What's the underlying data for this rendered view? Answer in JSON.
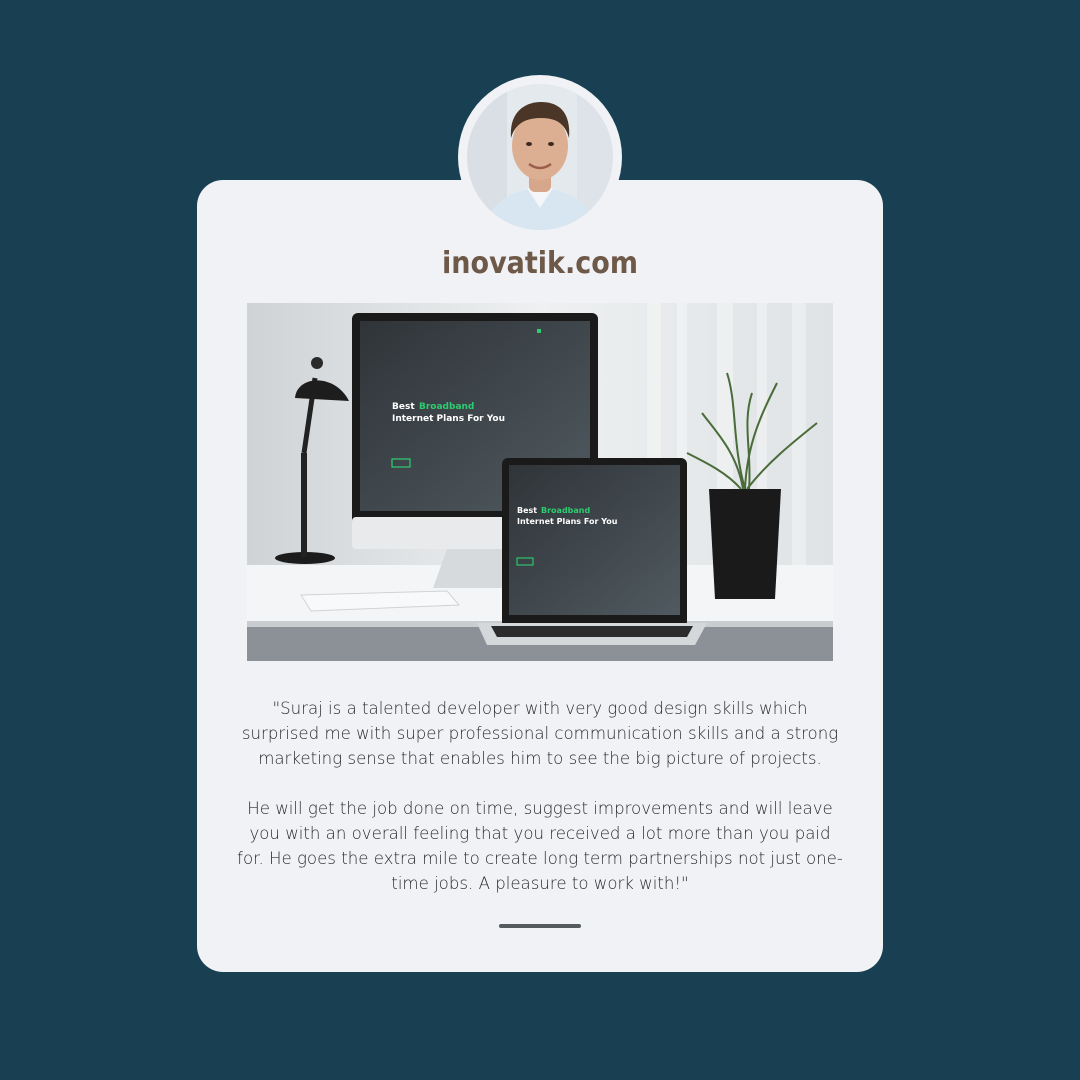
{
  "brand": {
    "name": "inovatik.com"
  },
  "colors": {
    "background": "#183f52",
    "card": "#f0f2f5",
    "brand_text": "#6e5848",
    "accent_green": "#2ecc71",
    "divider": "#555a5e"
  },
  "hero": {
    "screen_headline_line1_a": "Best ",
    "screen_headline_line1_b": "Broadband",
    "screen_headline_line2": "Internet Plans For You"
  },
  "testimonial": {
    "paragraph1": "\"Suraj is a talented developer with very good design skills which surprised me with super professional communication skills and a strong marketing sense that enables him to see the big picture of projects.",
    "paragraph2": "He will get the job done on time, suggest improvements and will leave you with an overall feeling that you received a lot more than you paid for. He goes the extra mile to create long term partnerships not just one-time jobs. A pleasure to work with!\""
  }
}
